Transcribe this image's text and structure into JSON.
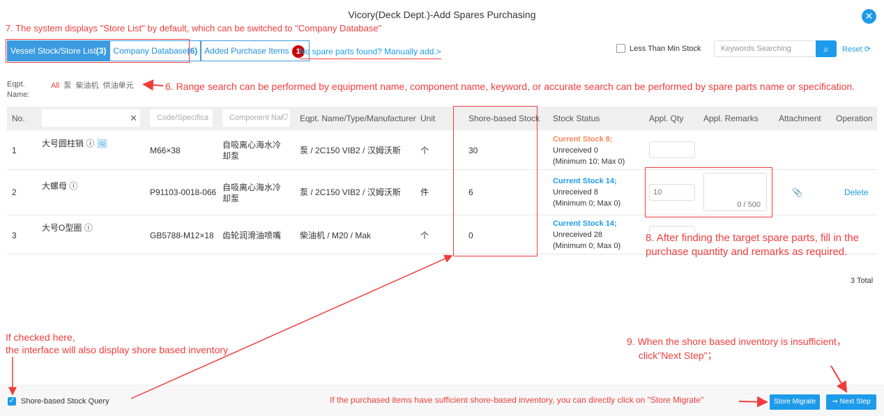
{
  "title": "Vicory(Deck Dept.)-Add Spares Purchasing",
  "tabs": [
    {
      "label": "Vessel Stock/Store List",
      "count": "(3)"
    },
    {
      "label": "Company Database",
      "count": "(6)"
    },
    {
      "label": "Added Purchase Items",
      "badge": "1"
    }
  ],
  "manual_add": "No spare parts found? Manually add.>",
  "less_than_min": "Less Than Min Stock",
  "search_placeholder": "Keywords Searching",
  "reset": "Reset",
  "eqpt_label": "Eqpt. Name:",
  "eqpt_filters": [
    "All",
    "泵",
    "柴油机",
    "供油单元"
  ],
  "columns": {
    "no": "No.",
    "code": "Code/Specifica",
    "component": "Component Nar",
    "eqpt": "Eqpt. Name/Type/Manufacturer",
    "unit": "Unit",
    "shore": "Shore-based Stock",
    "status": "Stock Status",
    "qty": "Appl. Qty",
    "remarks": "Appl. Remarks",
    "attachment": "Attachment",
    "operation": "Operation"
  },
  "rows": [
    {
      "no": "1",
      "name": "大号圆柱销",
      "code": "M66×38",
      "component": "自吸离心海水冷却泵",
      "eqpt": "泵 / 2C150 VIB2 / 汉姆沃斯",
      "unit": "个",
      "shore": "30",
      "stock": "Current Stock 8;",
      "unrec": "Unreceived 0",
      "minmax": "(Minimum 10; Max 0)",
      "qty": "",
      "remarks": "",
      "delete": ""
    },
    {
      "no": "2",
      "name": "大螺母",
      "code": "P91103-0018-066",
      "component": "自吸离心海水冷却泵",
      "eqpt": "泵 / 2C150 VIB2 / 汉姆沃斯",
      "unit": "件",
      "shore": "6",
      "stock": "Current Stock 14;",
      "unrec": "Unreceived 8",
      "minmax": "(Minimum 0; Max 0)",
      "qty": "10",
      "remarks_count": "0 / 500",
      "delete": "Delete"
    },
    {
      "no": "3",
      "name": "大号O型圈",
      "code": "GB5788-M12×18",
      "component": "齿轮润滑油喷嘴",
      "eqpt": "柴油机 / M20 / Mak",
      "unit": "个",
      "shore": "0",
      "stock": "Current Stock 14;",
      "unrec": "Unreceived 28",
      "minmax": "(Minimum 0; Max 0)",
      "qty": "",
      "delete": ""
    }
  ],
  "total": "3 Total",
  "footer": {
    "shore_query": "Shore-based Stock Query",
    "store_migrate": "Store Migrate",
    "next_step": "Next Step",
    "shore_query_checked": true
  },
  "annotations": {
    "a7": "7. The system displays \"Store List\" by default, which can be switched to \"Company Database\"",
    "a6": "6. Range search can be performed by equipment name, component name, keyword, or accurate search can be performed by spare parts name or specification.",
    "a8_1": "8. After finding the target spare parts, fill in the",
    "a8_2": "purchase quantity and remarks as required.",
    "check_1": "If checked here,",
    "check_2": "the interface will also display shore based inventory",
    "a9_1": "9. When the shore based inventory is insufficient，",
    "a9_2": "click\"Next Step\"；",
    "migrate": "If the purchased items have sufficient shore-based inventory, you can directly click on \"Store Migrate\""
  },
  "colors": {
    "accent": "#1d9bea",
    "warning": "#f6875a",
    "annotation": "#f03c3c"
  }
}
